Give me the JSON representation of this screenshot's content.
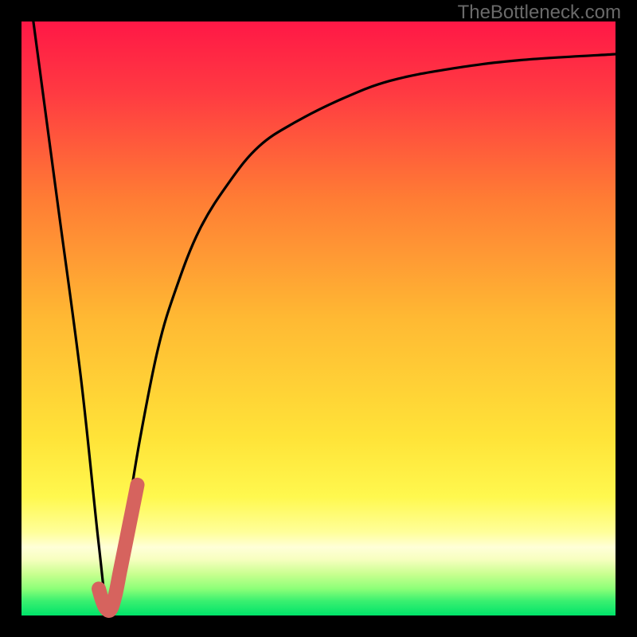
{
  "watermark": "TheBottleneck.com",
  "colors": {
    "gradient_top": "#ff1846",
    "gradient_mid1": "#ff8c2e",
    "gradient_mid2": "#ffe338",
    "gradient_band": "#ffff9a",
    "gradient_bottom": "#00e36a",
    "curve": "#000000",
    "marker": "#d6635e",
    "frame": "#000000"
  },
  "chart_data": {
    "type": "line",
    "title": "",
    "xlabel": "",
    "ylabel": "",
    "xlim": [
      0,
      100
    ],
    "ylim": [
      0,
      100
    ],
    "series": [
      {
        "name": "bottleneck-curve",
        "x": [
          2,
          6,
          10,
          13,
          14.5,
          16,
          18,
          20,
          23,
          26,
          30,
          35,
          40,
          46,
          54,
          62,
          72,
          84,
          100
        ],
        "y": [
          100,
          70,
          40,
          12,
          1,
          6,
          18,
          30,
          45,
          55,
          65,
          73,
          79,
          83,
          87,
          90,
          92,
          93.5,
          94.5
        ]
      },
      {
        "name": "optimal-marker",
        "x": [
          13.0,
          13.6,
          14.2,
          15.0,
          15.8,
          16.6,
          17.6,
          18.6,
          19.5
        ],
        "y": [
          4.5,
          2.5,
          1.2,
          1.0,
          3.5,
          7.5,
          12.5,
          17.5,
          22.0
        ]
      }
    ],
    "annotations": []
  }
}
